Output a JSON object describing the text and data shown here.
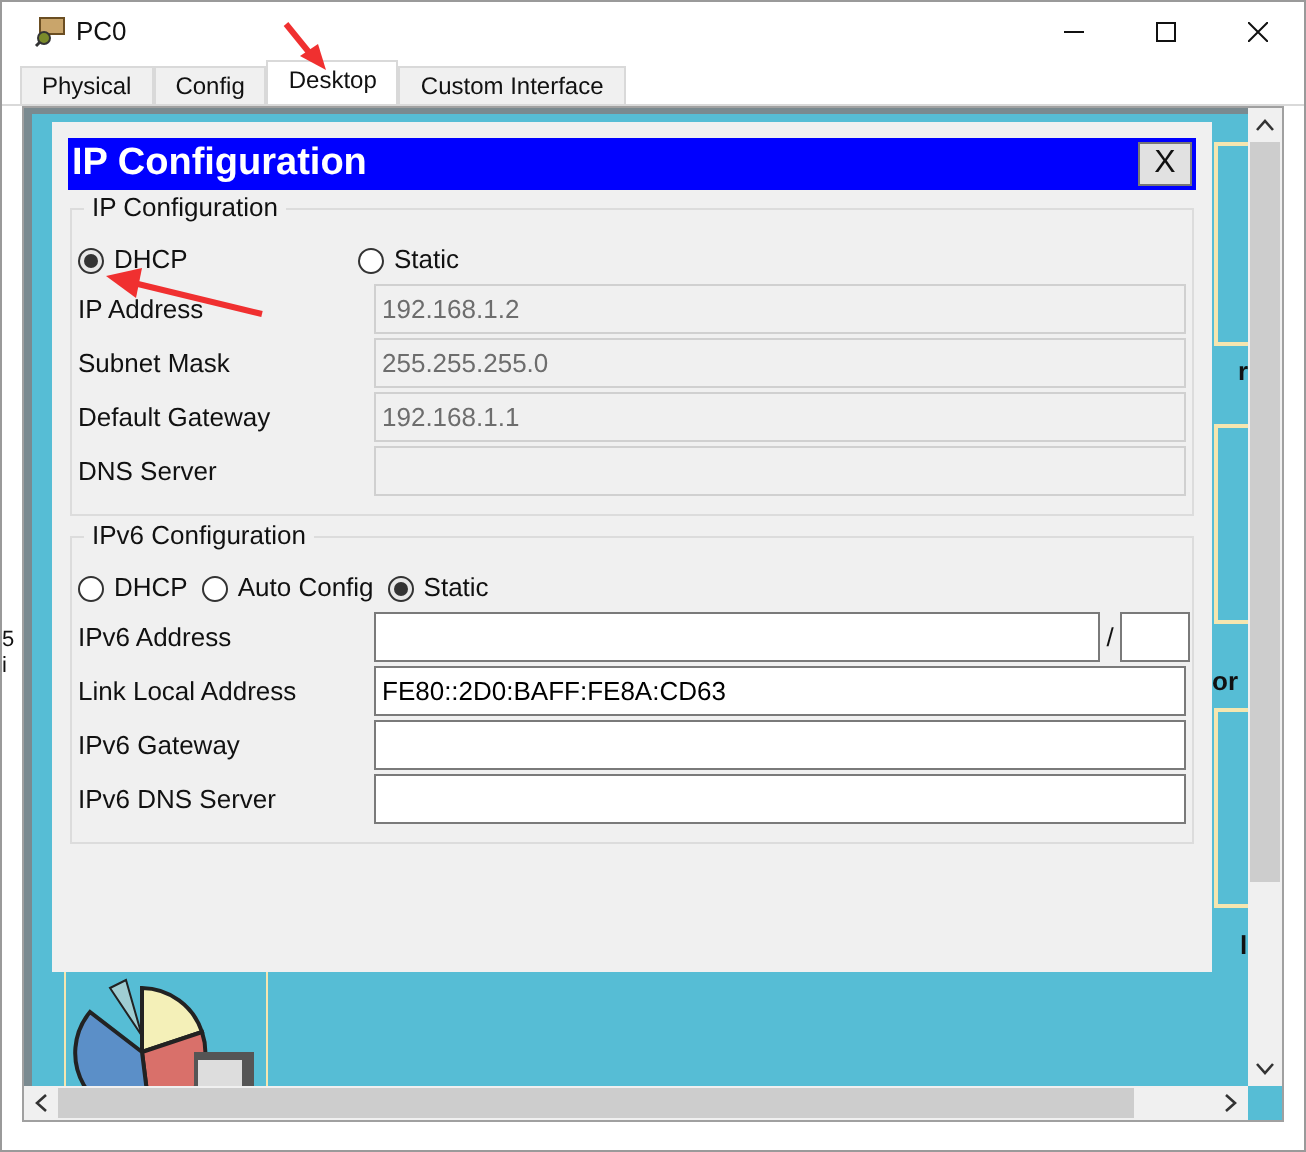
{
  "window": {
    "title": "PC0"
  },
  "tabs": [
    {
      "label": "Physical",
      "selected": false
    },
    {
      "label": "Config",
      "selected": false
    },
    {
      "label": "Desktop",
      "selected": true
    },
    {
      "label": "Custom Interface",
      "selected": false
    }
  ],
  "background_text": [
    "5",
    "i",
    "r",
    "or",
    "l"
  ],
  "dialog": {
    "title": "IP Configuration",
    "close_label": "X",
    "ipv4": {
      "legend": "IP Configuration",
      "modes": [
        {
          "label": "DHCP",
          "selected": true
        },
        {
          "label": "Static",
          "selected": false
        }
      ],
      "fields": [
        {
          "label": "IP Address",
          "value": "192.168.1.2",
          "disabled": true
        },
        {
          "label": "Subnet Mask",
          "value": "255.255.255.0",
          "disabled": true
        },
        {
          "label": "Default Gateway",
          "value": "192.168.1.1",
          "disabled": true
        },
        {
          "label": "DNS Server",
          "disabled": true
        }
      ]
    },
    "ipv6": {
      "legend": "IPv6 Configuration",
      "modes": [
        {
          "label": "DHCP",
          "selected": false
        },
        {
          "label": "Auto Config",
          "selected": false
        },
        {
          "label": "Static",
          "selected": true
        }
      ],
      "fields": [
        {
          "label": "IPv6 Address",
          "kind": "prefix",
          "disabled": false,
          "separator": "/"
        },
        {
          "label": "Link Local Address",
          "kind": "plain",
          "value": "FE80::2D0:BAFF:FE8A:CD63",
          "disabled": false
        },
        {
          "label": "IPv6 Gateway",
          "kind": "plain",
          "disabled": false
        },
        {
          "label": "IPv6 DNS Server",
          "kind": "plain",
          "disabled": false
        }
      ]
    }
  }
}
